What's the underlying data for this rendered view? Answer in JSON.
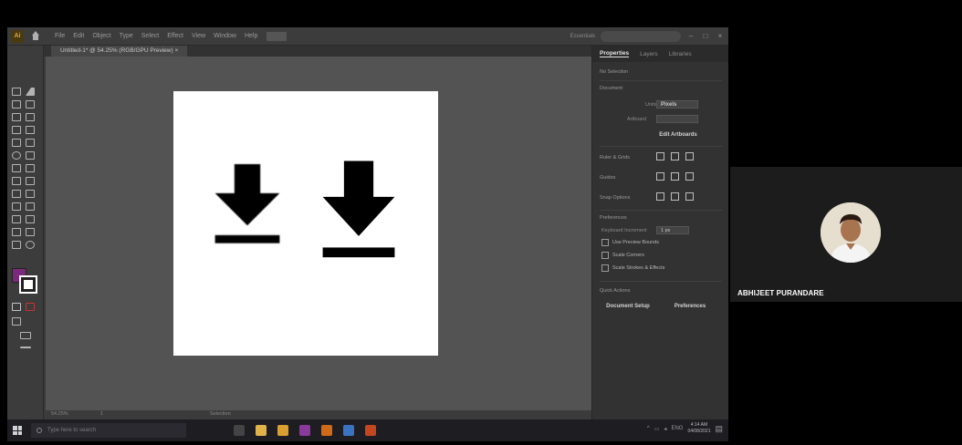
{
  "app": {
    "logo_text": "Ai",
    "menu": [
      "File",
      "Edit",
      "Object",
      "Type",
      "Select",
      "Effect",
      "View",
      "Window",
      "Help"
    ],
    "search_placeholder": "",
    "workspace_label": "Essentials",
    "document_tab": "Untitled-1* @ 54.25% (RGB/GPU Preview)"
  },
  "panel": {
    "tabs": [
      "Properties",
      "Layers",
      "Libraries"
    ],
    "no_selection": "No Selection",
    "document_header": "Document",
    "units_label": "Units",
    "units_value": "Pixels",
    "artboard_label": "Artboard",
    "edit_artboards": "Edit Artboards",
    "ruler_grids": "Ruler & Grids",
    "guides": "Guides",
    "snap_options": "Snap Options",
    "preferences": "Preferences",
    "keyboard_increment": "Keyboard Increment",
    "keyboard_increment_value": "1 px",
    "checkboxes": [
      "Use Preview Bounds",
      "Scale Corners",
      "Scale Strokes & Effects"
    ],
    "quick_actions": "Quick Actions",
    "document_setup": "Document Setup",
    "preferences_button": "Preferences"
  },
  "status": {
    "zoom": "54.25%",
    "artboard_nav": "1",
    "selection": "Selection"
  },
  "taskbar": {
    "search_text": "Type here to search",
    "lang": "ENG",
    "clock_time": "4:14 AM",
    "clock_date": "04/08/2021",
    "icons": [
      {
        "name": "task-view-icon",
        "color": "#444444"
      },
      {
        "name": "file-explorer-icon",
        "color": "#e0b34a"
      },
      {
        "name": "chrome-icon",
        "color": "#d9a030"
      },
      {
        "name": "media-icon",
        "color": "#8a3a9a"
      },
      {
        "name": "illustrator-taskbar-icon",
        "color": "#d06a1a"
      },
      {
        "name": "photos-icon",
        "color": "#3a74c0"
      },
      {
        "name": "powerpoint-icon",
        "color": "#c2471e"
      }
    ]
  },
  "participant": {
    "name": "ABHIJEET PURANDARE"
  },
  "colors": {
    "fill_swatch": "#7b2a7b",
    "canvas": "#535353",
    "artboard": "#ffffff"
  }
}
